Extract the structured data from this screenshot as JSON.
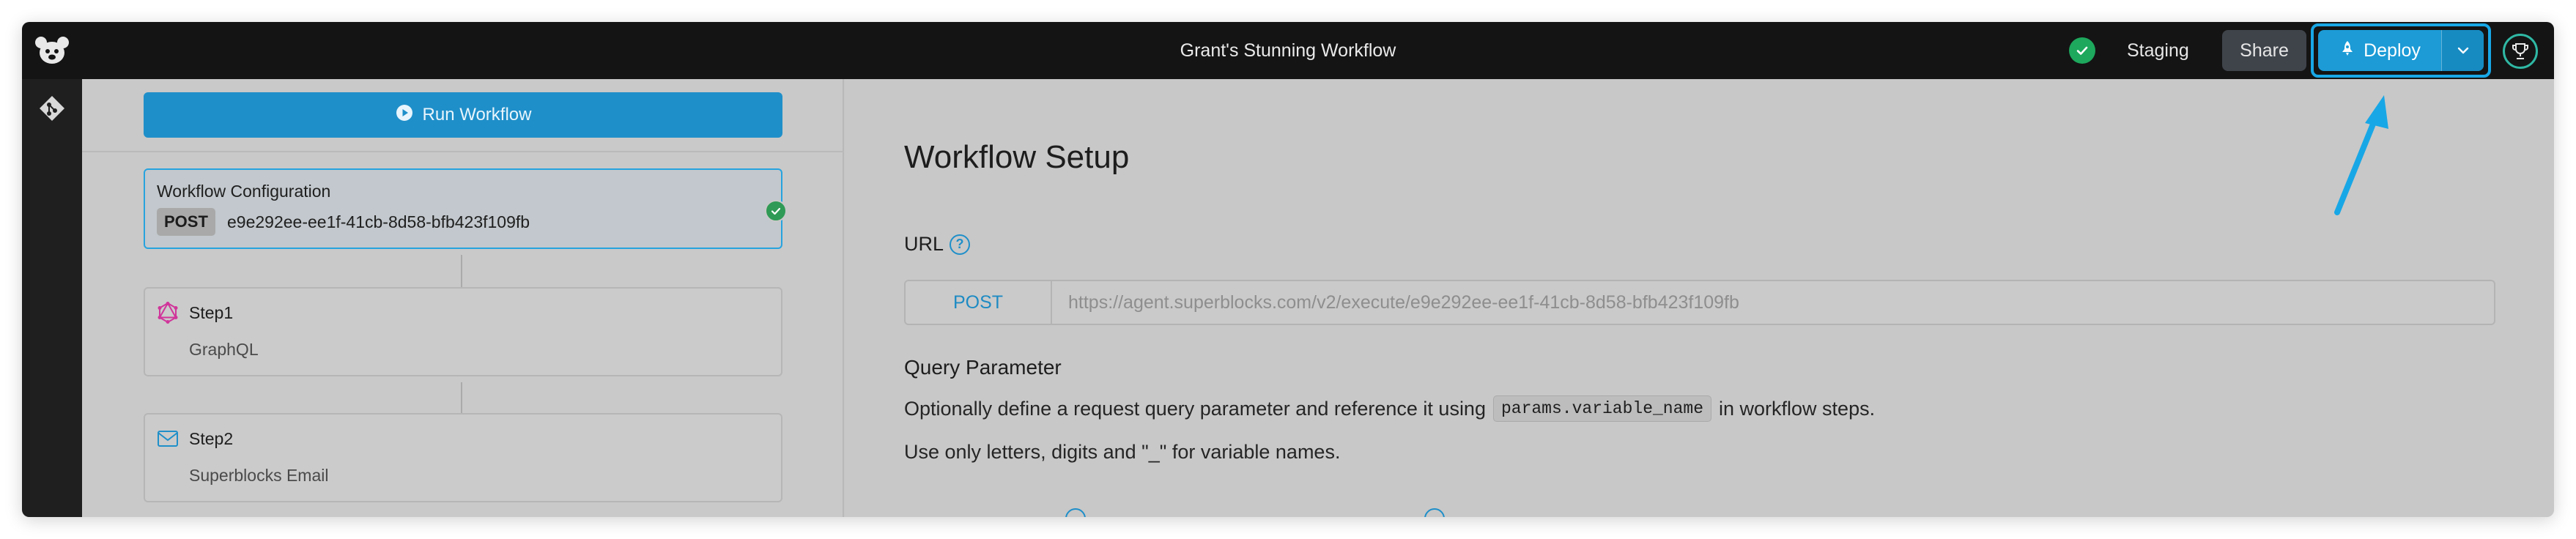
{
  "topbar": {
    "workflow_title": "Grant's Stunning Workflow",
    "environment": "Staging",
    "share_label": "Share",
    "deploy_label": "Deploy",
    "status_icon": "check-circle-icon",
    "status_color": "#1da85d",
    "accent_color": "#1c9bd6"
  },
  "run_button": {
    "label": "Run Workflow"
  },
  "nodes": [
    {
      "title": "Workflow Configuration",
      "method": "POST",
      "id": "e9e292ee-ee1f-41cb-8d58-bfb423f109fb"
    },
    {
      "title": "Step1",
      "subtitle": "GraphQL",
      "icon": "graphql-icon"
    },
    {
      "title": "Step2",
      "subtitle": "Superblocks Email",
      "icon": "envelope-icon"
    }
  ],
  "main": {
    "title": "Workflow Setup",
    "url_label": "URL",
    "url_method": "POST",
    "url_value": "https://agent.superblocks.com/v2/execute/e9e292ee-ee1f-41cb-8d58-bfb423f109fb",
    "query_param_title": "Query Parameter",
    "qp_line1_before": "Optionally define a request query parameter and reference it using",
    "qp_code": "params.variable_name",
    "qp_line1_after": "in workflow steps.",
    "qp_line2": "Use only letters, digits and \"_\" for variable names."
  }
}
